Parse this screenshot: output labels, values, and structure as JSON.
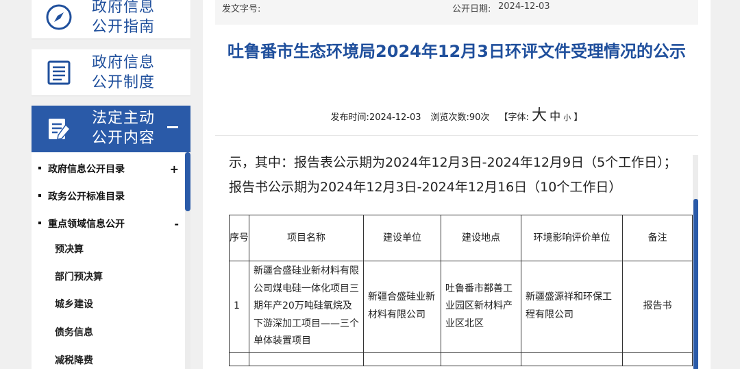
{
  "sidebar": {
    "cards": [
      {
        "label": "政府信息\n公开指南",
        "icon": "compass-icon"
      },
      {
        "label": "政府信息\n公开制度",
        "icon": "document-list-icon"
      },
      {
        "label": "法定主动\n公开内容",
        "icon": "edit-document-icon",
        "toggle": "−"
      }
    ],
    "submenu": [
      {
        "label": "政府信息公开目录",
        "toggle": "+"
      },
      {
        "label": "政务公开标准目录",
        "toggle": ""
      },
      {
        "label": "重点领域信息公开",
        "toggle": "-"
      }
    ],
    "leaves": [
      "预决算",
      "部门预决算",
      "城乡建设",
      "债务信息",
      "减税降费"
    ]
  },
  "article": {
    "doc_no_label": "发文字号:",
    "open_date_label": "公开日期:",
    "open_date": "2024-12-03",
    "title": "吐鲁番市生态环境局2024年12月3日环评文件受理情况的公示",
    "publish_label": "发布时间:",
    "publish_date": "2024-12-03",
    "views_label": "浏览次数:",
    "views": "90次",
    "font_label": "【字体:",
    "font_large": "大",
    "font_medium": "中",
    "font_small": "小",
    "font_close": "】",
    "intro": "示，其中：报告表公示期为2024年12月3日-2024年12月9日（5个工作日）；报告书公示期为2024年12月3日-2024年12月16日（10个工作日）"
  },
  "table": {
    "headers": [
      "序号",
      "项目名称",
      "建设单位",
      "建设地点",
      "环境影响评价单位",
      "备注"
    ],
    "rows": [
      {
        "no": "1",
        "project": "新疆合盛硅业新材料有限公司煤电硅一体化项目三期年产20万吨硅氧烷及下游深加工项目——三个单体装置项目",
        "builder": "新疆合盛硅业新材料有限公司",
        "location": "吐鲁番市鄯善工业园区新材料产业区北区",
        "evaluator": "新疆盛源祥和环保工程有限公司",
        "note": "报告书"
      }
    ]
  },
  "colors": {
    "brand": "#1f4f9c",
    "active_bg": "#2a5aa8"
  }
}
